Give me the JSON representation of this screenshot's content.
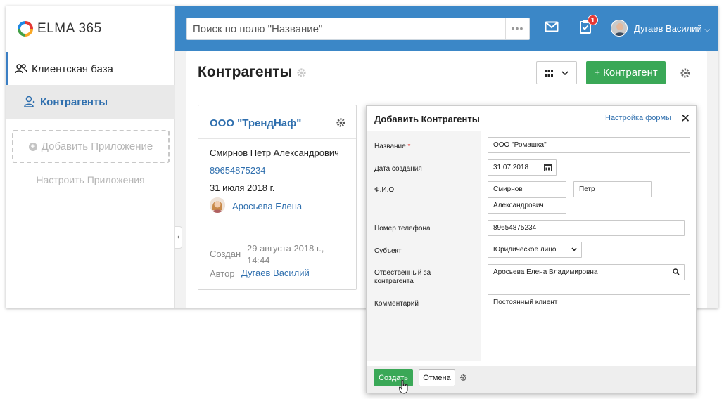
{
  "brand": {
    "name": "ELMA",
    "version": "365"
  },
  "sidebar": {
    "items": [
      {
        "label": "Клиентская база"
      },
      {
        "label": "Контрагенты"
      }
    ],
    "add_app_label": "Добавить Приложение",
    "configure_apps_label": "Настроить Приложения"
  },
  "header": {
    "search_placeholder": "Поиск по полю \"Название\"",
    "search_more": "•••",
    "tasks_badge": "1",
    "user_name": "Дугаев Василий"
  },
  "page": {
    "title": "Контрагенты",
    "add_button_label": "+ Контрагент"
  },
  "card": {
    "title": "ООО \"ТрендНаф\"",
    "person": "Смирнов Петр Александрович",
    "phone": "89654875234",
    "date": "31 июля 2018 г.",
    "responsible": "Аросьева Елена",
    "created_label": "Создан",
    "created_value_line1": "29 августа 2018 г.,",
    "created_value_line2": "14:44",
    "author_label": "Автор",
    "author_value": "Дугаев Василий"
  },
  "dialog": {
    "title": "Добавить Контрагенты",
    "form_settings_label": "Настройка формы",
    "close_label": "✕",
    "fields": {
      "name": {
        "label": "Название",
        "required_mark": "*",
        "value": "ООО \"Ромашка\""
      },
      "created_date": {
        "label": "Дата создания",
        "value": "31.07.2018"
      },
      "fio": {
        "label": "Ф.И.О.",
        "last_name": "Смирнов",
        "first_name": "Петр",
        "middle_name": "Александрович"
      },
      "phone": {
        "label": "Номер телефона",
        "value": "89654875234"
      },
      "subject": {
        "label": "Субъект",
        "value": "Юридическое лицо"
      },
      "responsible": {
        "label_line1": "Отвественный за",
        "label_line2": "контрагента",
        "value": "Аросьева Елена Владимировна"
      },
      "comment": {
        "label": "Комментарий",
        "value": "Постоянный клиент"
      }
    },
    "create_button_label": "Создать",
    "cancel_button_label": "Отмена"
  },
  "colors": {
    "header_blue": "#3b87c7",
    "accent_green": "#3aa857",
    "link_blue": "#2f6fae",
    "badge_red": "#e53935"
  },
  "icons": {
    "logo": "elma-logo-icon",
    "mail": "mail-icon",
    "tasks": "tasks-clipboard-icon",
    "settings": "gear-icon",
    "calendar": "calendar-icon",
    "search": "search-icon",
    "grid": "grid-view-icon"
  }
}
